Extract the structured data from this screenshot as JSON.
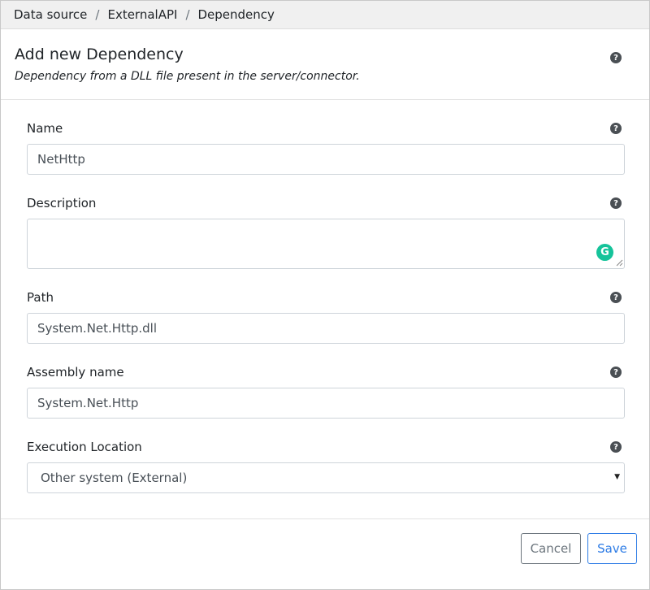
{
  "breadcrumb": [
    "Data source",
    "ExternalAPI",
    "Dependency"
  ],
  "breadcrumb_separator": "/",
  "header": {
    "title": "Add new Dependency",
    "subtitle": "Dependency from a DLL file present in the server/connector."
  },
  "help_glyph": "?",
  "fields": {
    "name": {
      "label": "Name",
      "value": "NetHttp"
    },
    "description": {
      "label": "Description",
      "value": ""
    },
    "path": {
      "label": "Path",
      "value": "System.Net.Http.dll"
    },
    "assembly": {
      "label": "Assembly name",
      "value": "System.Net.Http"
    },
    "execution": {
      "label": "Execution Location",
      "selected": "Other system (External)"
    }
  },
  "grammarly_glyph": "G",
  "buttons": {
    "cancel": "Cancel",
    "save": "Save"
  },
  "colors": {
    "primary": "#2c7be5",
    "secondary": "#6c757d",
    "grammarly": "#15c39a"
  }
}
